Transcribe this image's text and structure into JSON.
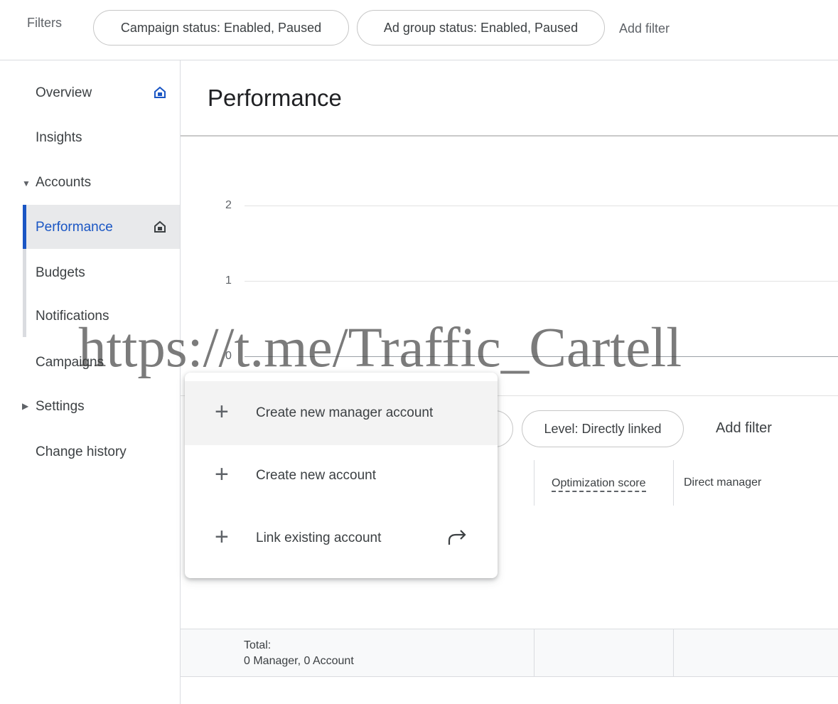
{
  "filters": {
    "label": "Filters",
    "chips": [
      "Campaign status: Enabled, Paused",
      "Ad group status: Enabled, Paused"
    ],
    "add_filter": "Add filter"
  },
  "sidebar": {
    "items": [
      {
        "label": "Overview",
        "icon": "home-icon"
      },
      {
        "label": "Insights"
      },
      {
        "label": "Accounts",
        "expanded": true
      },
      {
        "label": "Performance",
        "icon": "home-icon",
        "active": true
      },
      {
        "label": "Budgets"
      },
      {
        "label": "Notifications"
      },
      {
        "label": "Campaigns"
      },
      {
        "label": "Settings",
        "expanded": false
      },
      {
        "label": "Change history"
      }
    ],
    "accent_color": "#1a56c4"
  },
  "main": {
    "title": "Performance",
    "chart": {
      "y_ticks": [
        "2",
        "1",
        "0"
      ]
    },
    "table_filter": {
      "chip": "Level: Directly linked",
      "add_filter": "Add filter"
    },
    "table": {
      "headers": [
        "Optimization score",
        "Direct manager"
      ],
      "total_label": "Total:",
      "total_value": "0 Manager, 0 Account"
    }
  },
  "menu": {
    "items": [
      {
        "label": "Create new manager account",
        "icon": "plus-icon"
      },
      {
        "label": "Create new account",
        "icon": "plus-icon"
      },
      {
        "label": "Link existing account",
        "icon": "plus-icon",
        "trailing_icon": "share-arrow-icon"
      }
    ]
  },
  "watermark": "https://t.me/Traffic_Cartell"
}
